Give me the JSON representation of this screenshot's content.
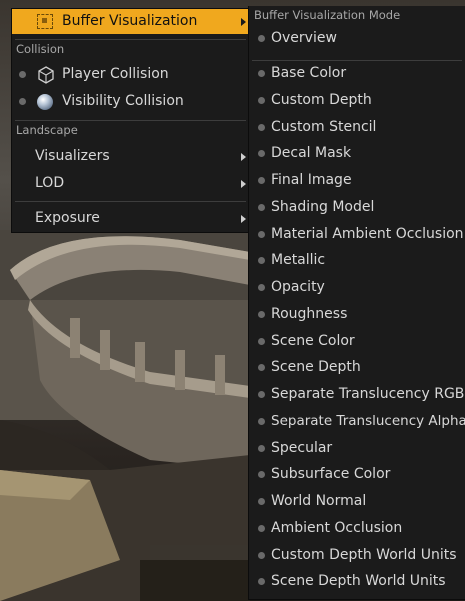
{
  "left_menu": {
    "buffer_visualization": "Buffer Visualization",
    "collision_header": "Collision",
    "player_collision": "Player Collision",
    "visibility_collision": "Visibility Collision",
    "landscape_header": "Landscape",
    "visualizers": "Visualizers",
    "lod": "LOD",
    "exposure": "Exposure"
  },
  "submenu": {
    "header": "Buffer Visualization Mode",
    "items": [
      "Overview",
      "Base Color",
      "Custom Depth",
      "Custom Stencil",
      "Decal Mask",
      "Final Image",
      "Shading Model",
      "Material Ambient Occlusion",
      "Metallic",
      "Opacity",
      "Roughness",
      "Scene Color",
      "Scene Depth",
      "Separate Translucency RGB",
      "Separate Translucency Alpha",
      "Specular",
      "Subsurface Color",
      "World Normal",
      "Ambient Occlusion",
      "Custom Depth World Units",
      "Scene Depth World Units"
    ]
  },
  "colors": {
    "accent": "#f0a81e",
    "menu_bg": "#1b1b1b",
    "text": "#d8d8d8",
    "section_text": "#a8a8a8"
  }
}
